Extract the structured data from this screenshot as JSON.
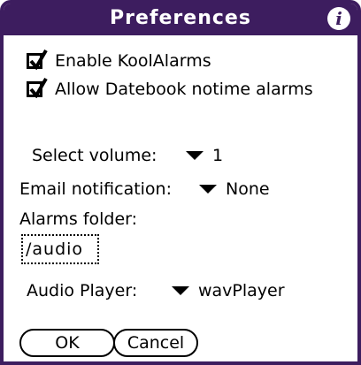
{
  "dialog": {
    "title": "Preferences",
    "info_icon": "i",
    "colors": {
      "title_bar": "#3d1d5f",
      "title_text": "#ffffff"
    }
  },
  "options": {
    "enable_koolalarms": {
      "label": "Enable KoolAlarms",
      "checked": true
    },
    "allow_datebook": {
      "label": "Allow Datebook notime alarms",
      "checked": true
    }
  },
  "volume": {
    "label": "Select volume:",
    "value": "1"
  },
  "email": {
    "label": "Email notification:",
    "value": "None"
  },
  "alarms_folder": {
    "label": "Alarms folder:",
    "value": "/audio"
  },
  "audio_player": {
    "label": "Audio Player:",
    "value": "wavPlayer"
  },
  "buttons": {
    "ok": "OK",
    "cancel": "Cancel"
  }
}
